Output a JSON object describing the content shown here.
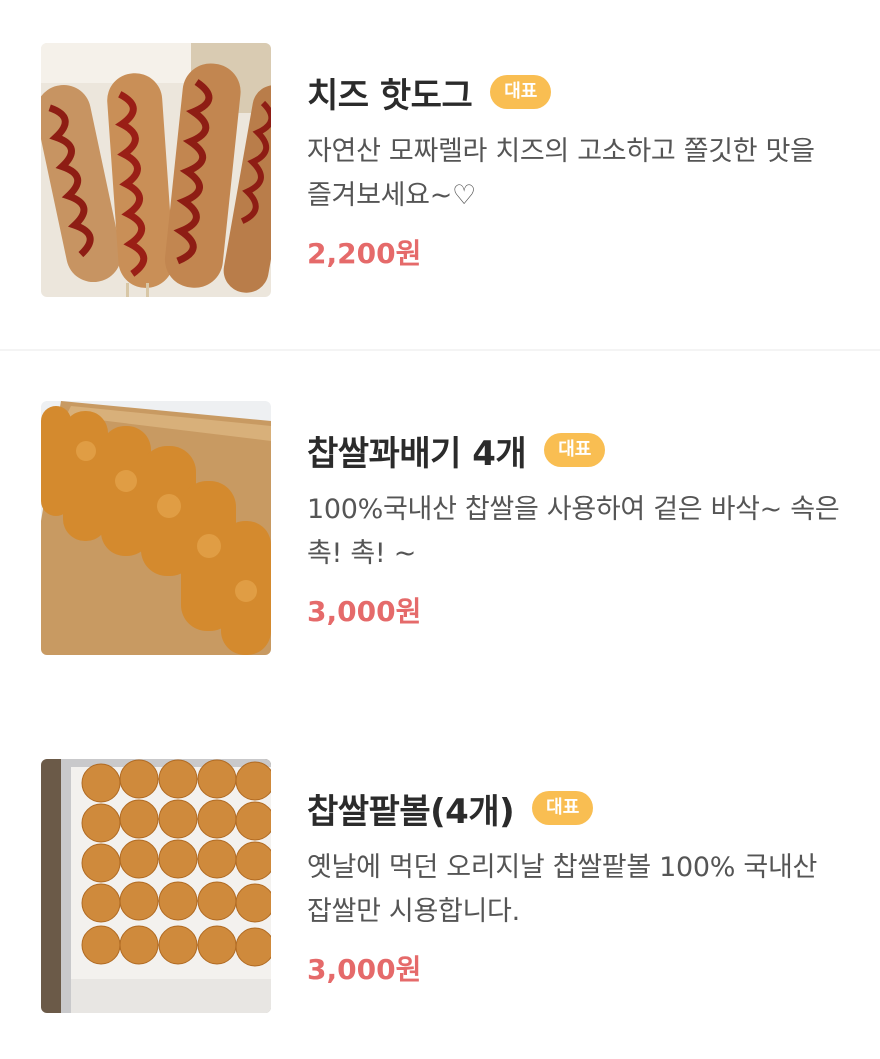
{
  "menu": {
    "items": [
      {
        "title": "치즈 핫도그",
        "badge": "대표",
        "description": "자연산 모짜렐라 치즈의 고소하고 쫄깃한 맛을 즐겨보세요~♡",
        "price": "2,200원",
        "image_icon": "cheese-hotdog-photo"
      },
      {
        "title": "찹쌀꽈배기 4개",
        "badge": "대표",
        "description": "100%국내산 찹쌀을 사용하여 겉은 바삭~ 속은 촉! 촉! ~",
        "price": "3,000원",
        "image_icon": "twisted-donut-photo"
      },
      {
        "title": "찹쌀팥볼(4개)",
        "badge": "대표",
        "description": "옛날에 먹던 오리지날 찹쌀팥볼 100% 국내산 잡쌀만 시용합니다.",
        "price": "3,000원",
        "image_icon": "red-bean-ball-photo"
      }
    ]
  },
  "colors": {
    "badge": "#f9be52",
    "price": "#e56a6a",
    "title": "#2b2b2b",
    "description": "#555555"
  }
}
